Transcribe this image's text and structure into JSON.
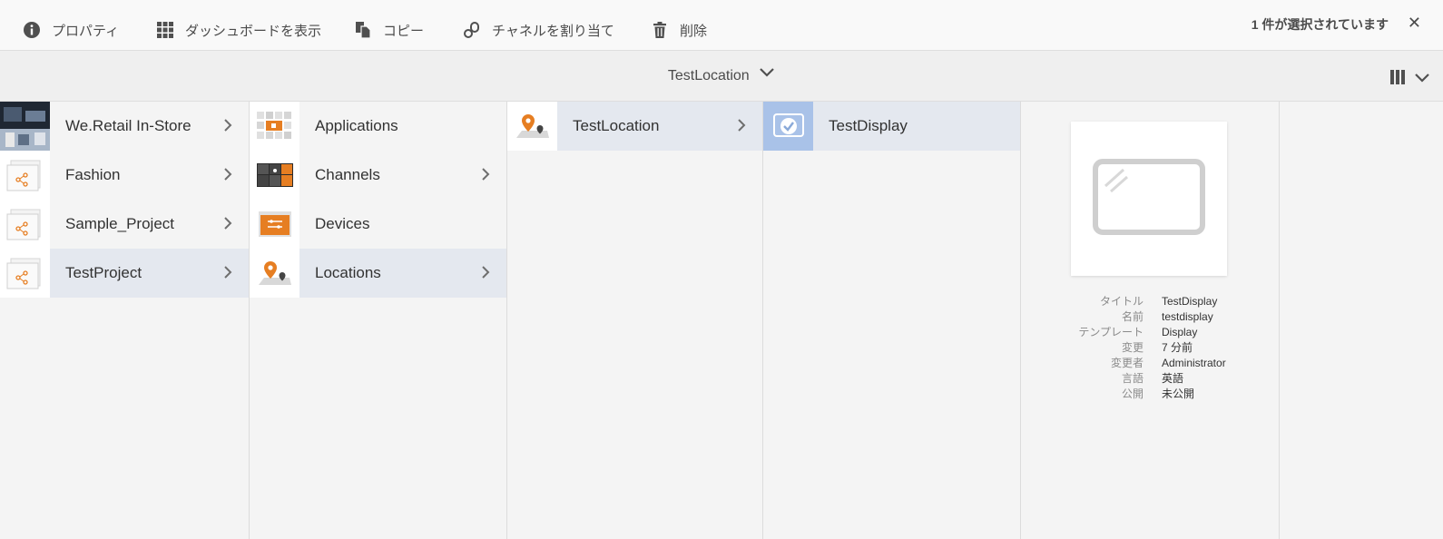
{
  "actionbar": {
    "properties_label": "プロパティ",
    "dashboard_label": "ダッシュボードを表示",
    "copy_label": "コピー",
    "assign_channel_label": "チャネルを割り当て",
    "delete_label": "削除",
    "selection_status": "1 件が選択されています"
  },
  "titlebar": {
    "title": "TestLocation"
  },
  "columns": {
    "projects": [
      {
        "label": "We.Retail In-Store",
        "has_children": true
      },
      {
        "label": "Fashion",
        "has_children": true
      },
      {
        "label": "Sample_Project",
        "has_children": true
      },
      {
        "label": "TestProject",
        "has_children": true,
        "active": true
      }
    ],
    "project_children": [
      {
        "label": "Applications",
        "has_children": false
      },
      {
        "label": "Channels",
        "has_children": true
      },
      {
        "label": "Devices",
        "has_children": false
      },
      {
        "label": "Locations",
        "has_children": true,
        "active": true
      }
    ],
    "locations": [
      {
        "label": "TestLocation",
        "has_children": true,
        "active": true
      }
    ],
    "displays": [
      {
        "label": "TestDisplay",
        "selected": true
      }
    ]
  },
  "meta": [
    {
      "key": "タイトル",
      "value": "TestDisplay"
    },
    {
      "key": "名前",
      "value": "testdisplay"
    },
    {
      "key": "テンプレート",
      "value": "Display"
    },
    {
      "key": "変更",
      "value": "7 分前"
    },
    {
      "key": "変更者",
      "value": "Administrator"
    },
    {
      "key": "言語",
      "value": "英語"
    },
    {
      "key": "公開",
      "value": "未公開"
    }
  ],
  "colors": {
    "accent": "#e67e22",
    "selected_thumb": "#a9c2e8",
    "active_row": "#e4e8ef"
  }
}
